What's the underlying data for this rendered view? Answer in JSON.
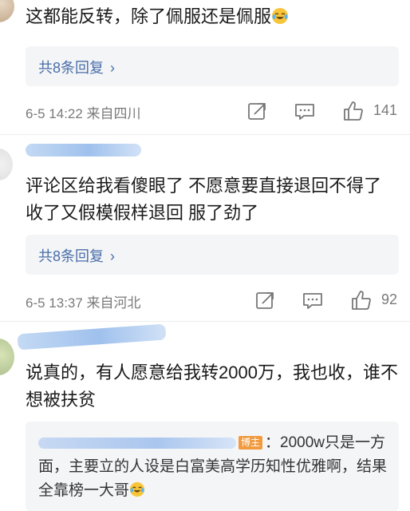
{
  "comments": [
    {
      "text": "这都能反转，除了佩服还是佩服",
      "reply_label": "共8条回复",
      "chevron": "›",
      "meta": "6-5 14:22 来自四川",
      "likes": "141"
    },
    {
      "text": "评论区给我看傻眼了 不愿意要直接退回不得了 收了又假模假样退回 服了劲了",
      "reply_label": "共8条回复",
      "chevron": "›",
      "meta": "6-5 13:37 来自河北",
      "likes": "92"
    },
    {
      "text": "说真的，有人愿意给我转2000万，我也收，谁不想被扶贫",
      "quote_badge": "博主",
      "quote_text": "：2000w只是一方面，主要立的人设是白富美高学历知性优雅啊，结果全靠榜一大哥"
    }
  ],
  "icons": {
    "share": "share-icon",
    "comment": "comment-icon",
    "like": "thumbs-up-icon",
    "emoji": "laughing-tears-emoji"
  },
  "colors": {
    "link": "#4a6ea9",
    "meta": "#7a7a7a",
    "reply_bg": "#f4f5f7",
    "badge": "#f19a3e"
  }
}
